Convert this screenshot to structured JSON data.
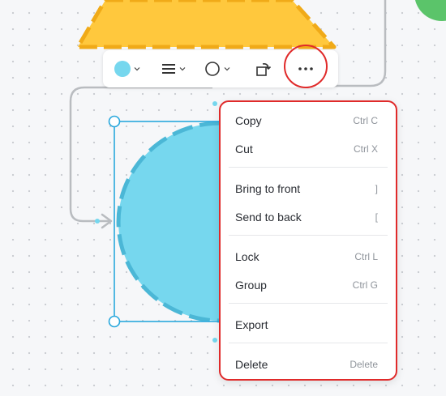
{
  "toolbar": {
    "fill_color": "#76d7ee",
    "tools": [
      {
        "name": "fill-color-tool",
        "icon": "color-dot"
      },
      {
        "name": "line-style-tool",
        "icon": "line-style-icon"
      },
      {
        "name": "shape-tool",
        "icon": "circle-shape-icon"
      },
      {
        "name": "replace-tool",
        "icon": "rotate-box-icon"
      },
      {
        "name": "more-options-button",
        "icon": "more-icon"
      }
    ],
    "more_label": "···"
  },
  "colors": {
    "highlight": "#e02a2a",
    "selection": "#29a8dd",
    "shape_fill": "#76d7ee",
    "triangle_fill": "#ffc83d",
    "triangle_border": "#f0aa18",
    "green_node": "#5bc46a"
  },
  "context_menu": {
    "items": [
      {
        "label": "Copy",
        "shortcut": "Ctrl C"
      },
      {
        "label": "Cut",
        "shortcut": "Ctrl X"
      },
      {
        "label": "Bring to front",
        "shortcut": "]"
      },
      {
        "label": "Send to back",
        "shortcut": "["
      },
      {
        "label": "Lock",
        "shortcut": "Ctrl L"
      },
      {
        "label": "Group",
        "shortcut": "Ctrl G"
      },
      {
        "label": "Export",
        "shortcut": ""
      },
      {
        "label": "Delete",
        "shortcut": "Delete"
      }
    ]
  }
}
